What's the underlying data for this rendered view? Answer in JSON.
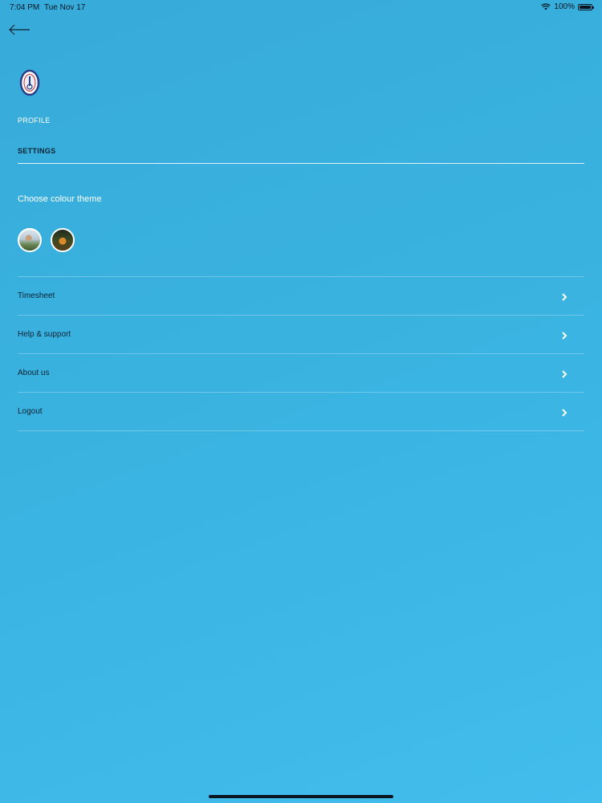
{
  "status_bar": {
    "time": "7:04 PM",
    "date": "Tue Nov 17",
    "battery": "100%",
    "battery_level": 1.0
  },
  "header": {
    "back_icon": "arrow-left-icon",
    "logo_icon": "shield-crest-logo"
  },
  "tabs": [
    {
      "label": "PROFILE",
      "active": false
    },
    {
      "label": "SETTINGS",
      "active": true
    }
  ],
  "theme": {
    "title": "Choose colour theme",
    "options": [
      "daylight-landscape-theme",
      "evening-lights-theme"
    ]
  },
  "menu": [
    {
      "label": "Timesheet"
    },
    {
      "label": "Help & support"
    },
    {
      "label": "About us"
    },
    {
      "label": "Logout"
    }
  ],
  "colors": {
    "background": "#3ab4e2",
    "text_dark": "#0d2233",
    "text_light": "#ffffff"
  }
}
